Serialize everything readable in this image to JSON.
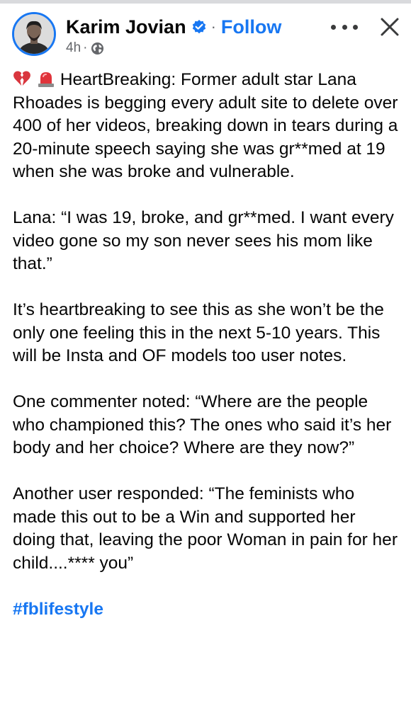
{
  "post": {
    "author": "Karim Jovian",
    "verified_icon": "verified-badge-icon",
    "separator": "·",
    "follow_label": "Follow",
    "time": "4h",
    "meta_separator": "·",
    "privacy_icon": "globe-icon",
    "more_icon": "more-options-icon",
    "close_icon": "close-icon",
    "accent_color": "#1877f2",
    "emoji_icons": [
      "broken-heart-emoji",
      "police-siren-emoji"
    ],
    "paragraphs": [
      "HeartBreaking: Former adult star Lana Rhoades is begging every adult site to delete over 400 of her videos, breaking down in tears during a 20-minute speech saying she was gr**med at 19 when she was broke and vulnerable.",
      "Lana: “I was 19, broke, and gr**med. I want every video gone so my son never sees his mom like that.”",
      "It’s heartbreaking to see this as she won’t be the only one feeling this in the next 5-10 years. This will be Insta and OF models too user notes.",
      "One commenter noted: “Where are the people who championed this? The ones who said it’s her body and her choice? Where are they now?”",
      "Another user responded: “The feminists who made this out to be a Win and supported her doing that, leaving the poor Woman in pain for her child....**** you”"
    ],
    "hashtag": "#fblifestyle"
  }
}
